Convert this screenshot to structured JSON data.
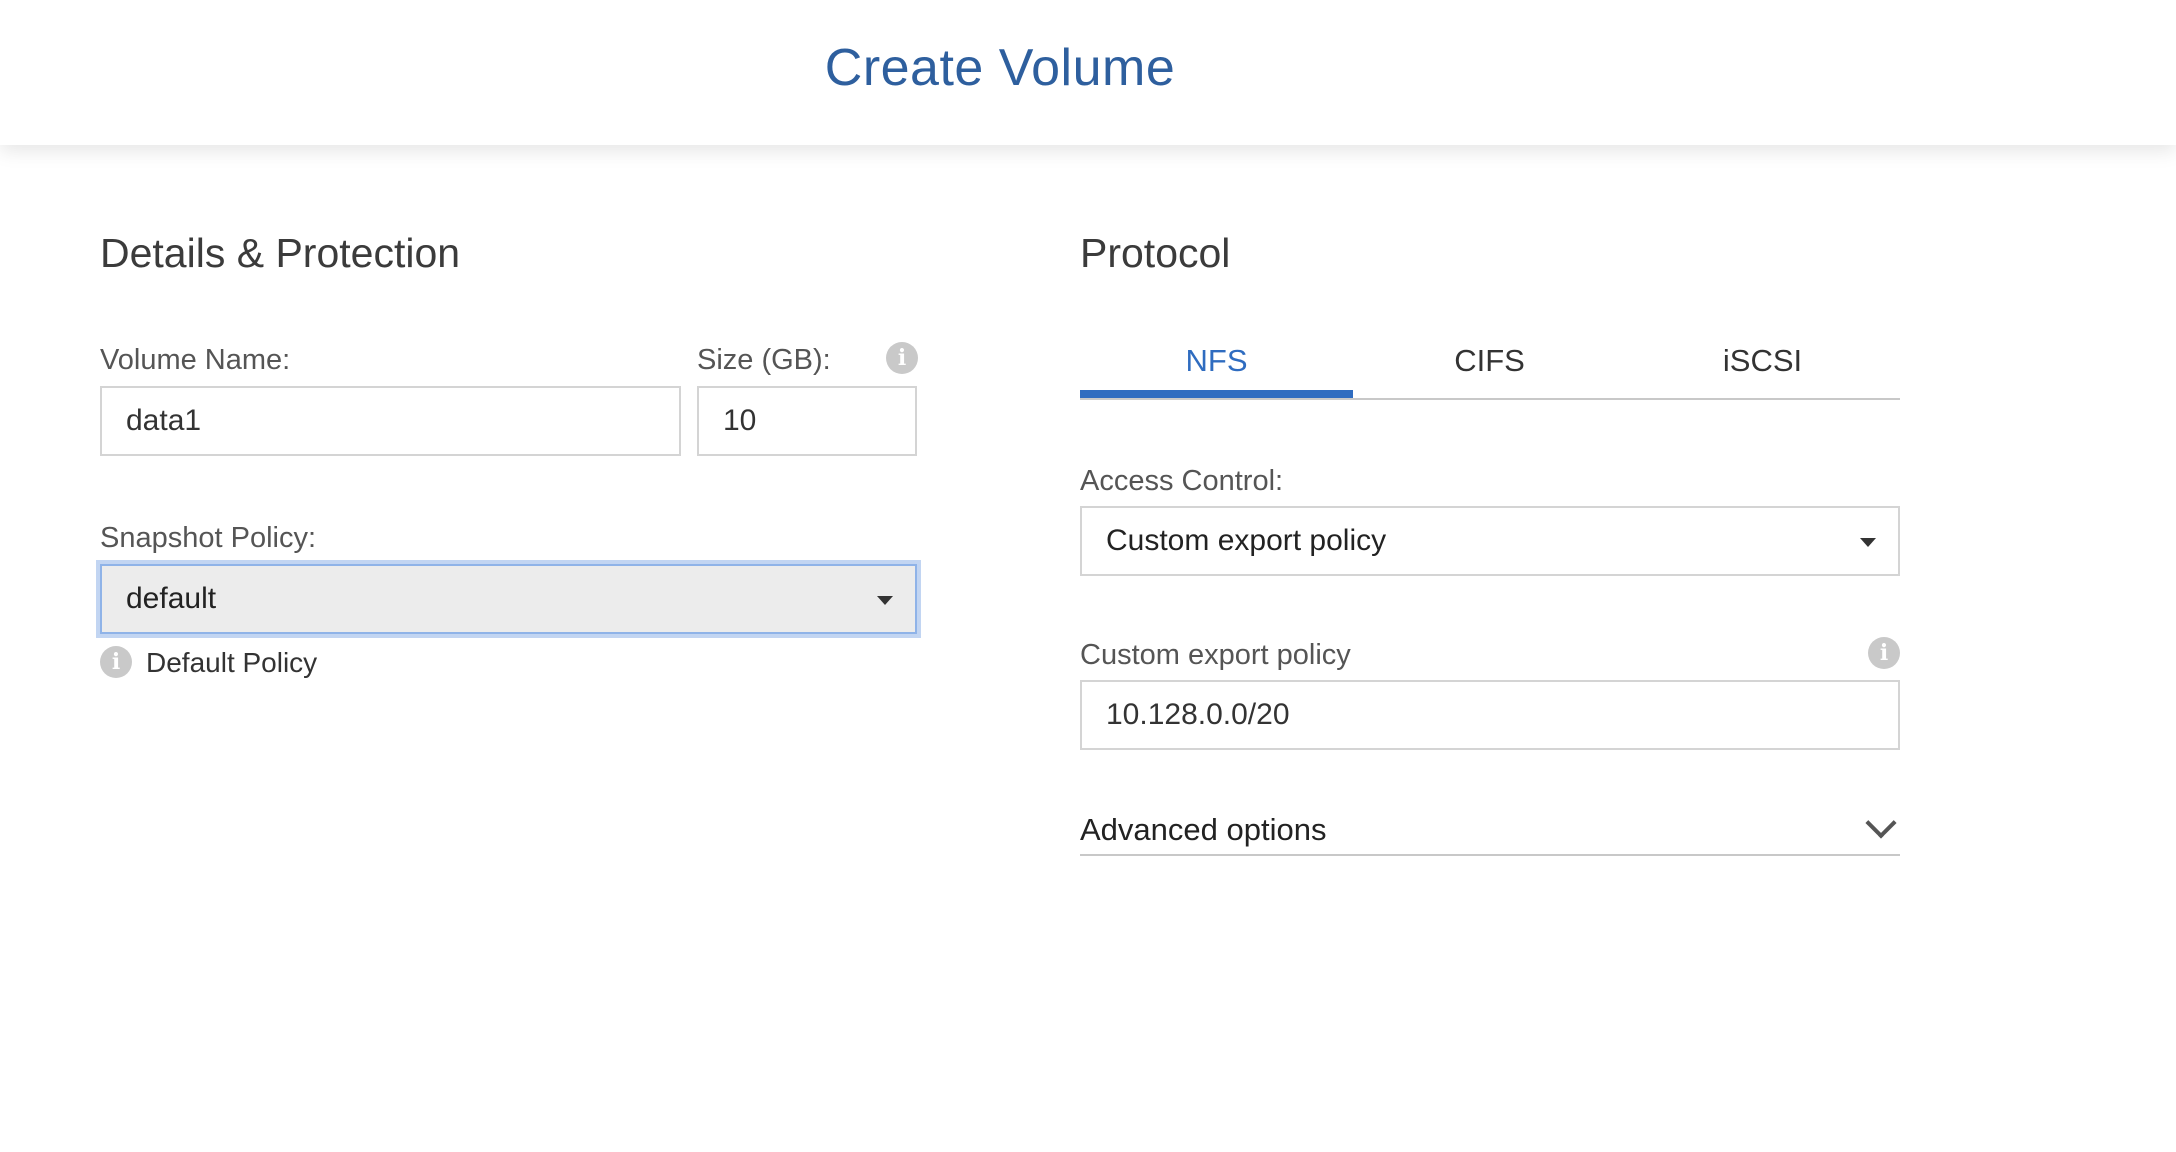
{
  "header": {
    "title": "Create Volume"
  },
  "details": {
    "title": "Details & Protection",
    "volume_name_label": "Volume Name:",
    "volume_name_value": "data1",
    "size_label": "Size (GB):",
    "size_value": "10",
    "size_info_icon": "i",
    "snapshot_label": "Snapshot Policy:",
    "snapshot_value": "default",
    "snapshot_hint_icon": "i",
    "snapshot_hint": "Default Policy"
  },
  "protocol": {
    "title": "Protocol",
    "tabs": [
      {
        "label": "NFS",
        "active": true
      },
      {
        "label": "CIFS",
        "active": false
      },
      {
        "label": "iSCSI",
        "active": false
      }
    ],
    "access_control_label": "Access Control:",
    "access_control_value": "Custom export policy",
    "export_policy_label": "Custom export policy",
    "export_policy_info_icon": "i",
    "export_policy_value": "10.128.0.0/20",
    "advanced_label": "Advanced options"
  },
  "colors": {
    "accent": "#2f6cc0",
    "header_title": "#2e5f9e",
    "focus_ring": "#8fb3e8"
  },
  "icons": [
    "info-icon",
    "caret-down-icon",
    "chevron-down-icon"
  ]
}
